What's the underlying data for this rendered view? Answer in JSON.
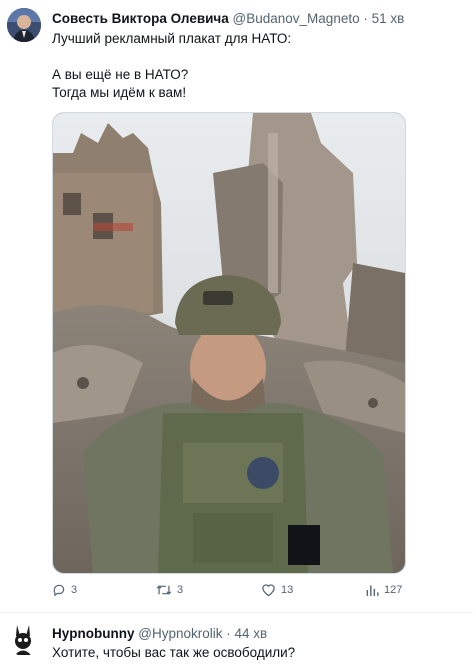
{
  "tweet1": {
    "author_name": "Совесть Виктора Олевича",
    "handle": "@Budanov_Magneto",
    "separator": "·",
    "time": "51 хв",
    "text_lines": [
      "Лучший рекламный плакат для НАТО:",
      "А вы ещё не в НАТО?",
      "Тогда мы идём к вам!"
    ],
    "stats": {
      "replies": "3",
      "retweets": "3",
      "likes": "13",
      "views": "127"
    }
  },
  "tweet2": {
    "author_name": "Hypnobunny",
    "handle": "@Hypnokrolik",
    "separator": "·",
    "time": "44 хв",
    "text": "Хотите, чтобы вас так же освободили?"
  },
  "icons": [
    "reply-icon",
    "retweet-icon",
    "like-icon",
    "views-icon"
  ],
  "colors": {
    "text": "#0f1419",
    "secondary": "#536471",
    "border": "#cfd9de"
  }
}
